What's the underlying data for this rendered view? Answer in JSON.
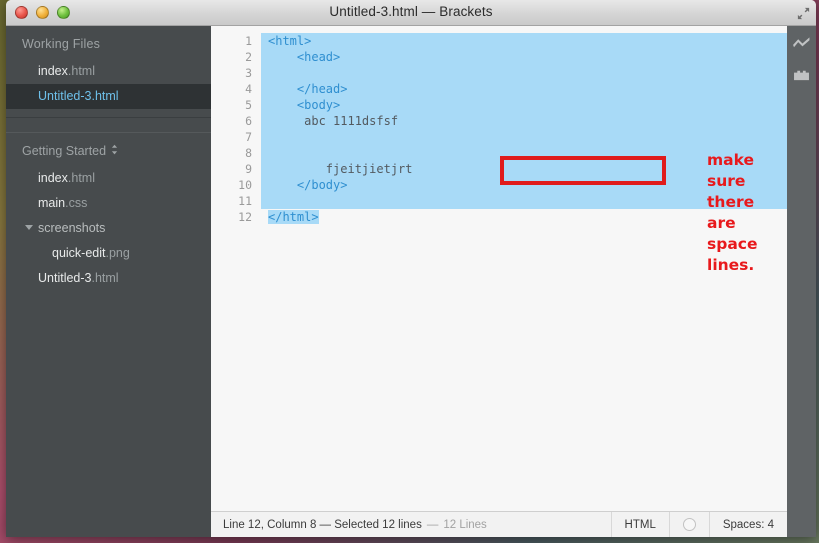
{
  "window": {
    "title": "Untitled-3.html — Brackets",
    "traffic_lights": [
      "close",
      "minimize",
      "zoom"
    ],
    "fullscreen_icon": "fullscreen-arrows-icon"
  },
  "sidebar": {
    "working_files": {
      "header": "Working Files",
      "items": [
        {
          "base": "index",
          "ext": ".html",
          "selected": false
        },
        {
          "base": "Untitled-3",
          "ext": ".html",
          "selected": true
        }
      ]
    },
    "project": {
      "header": "Getting Started",
      "header_icon": "updown-chevron-icon",
      "tree": [
        {
          "base": "index",
          "ext": ".html",
          "type": "file",
          "indent": 0
        },
        {
          "base": "main",
          "ext": ".css",
          "type": "file",
          "indent": 0
        },
        {
          "base": "screenshots",
          "ext": "",
          "type": "folder",
          "indent": 0,
          "expanded": true
        },
        {
          "base": "quick-edit",
          "ext": ".png",
          "type": "file",
          "indent": 1
        },
        {
          "base": "Untitled-3",
          "ext": ".html",
          "type": "file",
          "indent": 0
        }
      ]
    }
  },
  "editor": {
    "selection_color": "#a8daf7",
    "tag_color": "#2f8fd0",
    "text_color": "#535a60",
    "lines": [
      {
        "n": "1",
        "text": "<html>",
        "tag": true,
        "selected": "full"
      },
      {
        "n": "2",
        "text": "    <head>",
        "tag": true,
        "selected": "full"
      },
      {
        "n": "3",
        "text": "",
        "tag": false,
        "selected": "full"
      },
      {
        "n": "4",
        "text": "    </head>",
        "tag": true,
        "selected": "full"
      },
      {
        "n": "5",
        "text": "    <body>",
        "tag": true,
        "selected": "full"
      },
      {
        "n": "6",
        "text": "     abc 1111dsfsf",
        "tag": false,
        "selected": "full"
      },
      {
        "n": "7",
        "text": "",
        "tag": false,
        "selected": "full"
      },
      {
        "n": "8",
        "text": "",
        "tag": false,
        "selected": "full"
      },
      {
        "n": "9",
        "text": "        fjeitjietjrt",
        "tag": false,
        "selected": "full"
      },
      {
        "n": "10",
        "text": "    </body>",
        "tag": true,
        "selected": "full"
      },
      {
        "n": "11",
        "text": "",
        "tag": false,
        "selected": "full"
      },
      {
        "n": "12",
        "text": "</html>",
        "tag": true,
        "selected": "partial"
      }
    ]
  },
  "annotations": {
    "box": {
      "shape": "rectangle",
      "color": "#e01b1b"
    },
    "note": "make sure there\nare space lines."
  },
  "statusbar": {
    "cursor_info": "Line 12, Column 8 — Selected 12 lines",
    "separator": "—",
    "line_count": "12 Lines",
    "language": "HTML",
    "indicator_icon": "circle-icon",
    "indent": "Spaces:  4"
  },
  "right_toolbar": {
    "items": [
      {
        "icon": "lightning-bolt-icon",
        "name": "live-preview"
      },
      {
        "icon": "extension-brick-icon",
        "name": "extension-manager"
      }
    ]
  }
}
